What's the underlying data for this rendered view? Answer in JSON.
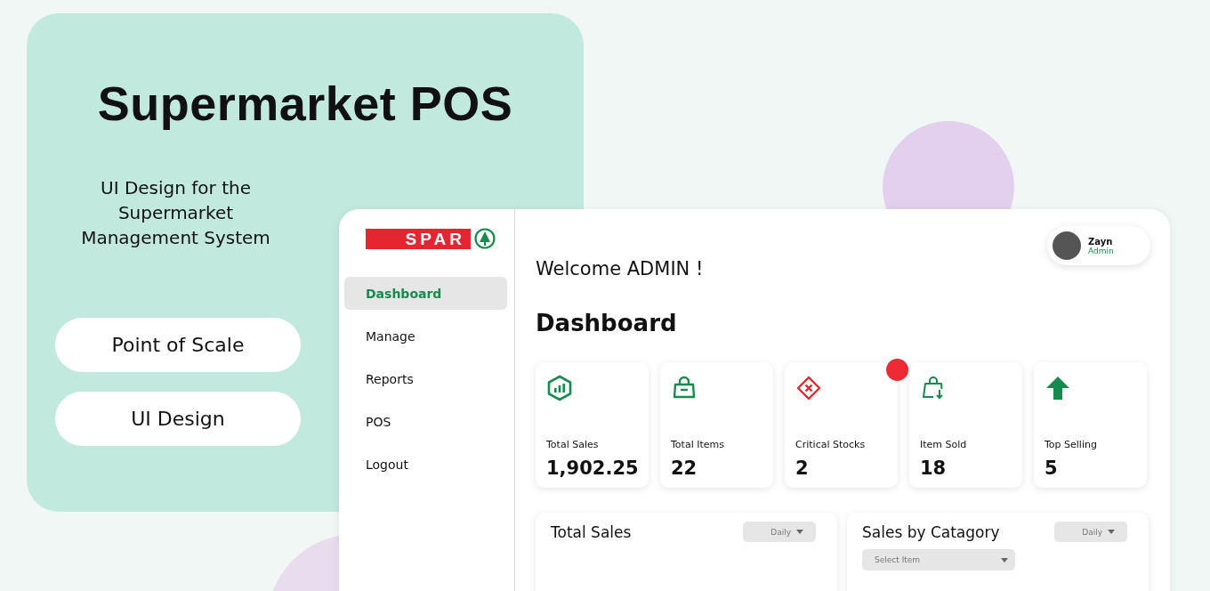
{
  "promo": {
    "title": "Supermarket POS",
    "subtitle": "UI Design for the Supermarket Management System",
    "tags": [
      "Point of Scale",
      "UI Design"
    ]
  },
  "app": {
    "logo": {
      "text": "SPAR"
    },
    "sidebar": {
      "items": [
        {
          "label": "Dashboard",
          "selected": true
        },
        {
          "label": "Manage",
          "selected": false
        },
        {
          "label": "Reports",
          "selected": false
        },
        {
          "label": "POS",
          "selected": false
        },
        {
          "label": "Logout",
          "selected": false
        }
      ]
    },
    "user": {
      "name": "Zayn",
      "role": "Admin"
    },
    "welcome": "Welcome ADMIN !",
    "heading": "Dashboard",
    "stats": [
      {
        "kind": "sales",
        "label": "Total Sales",
        "value": "1,902.25",
        "alert": false
      },
      {
        "kind": "items",
        "label": "Total Items",
        "value": "22",
        "alert": false
      },
      {
        "kind": "critical",
        "label": "Critical Stocks",
        "value": "2",
        "alert": true
      },
      {
        "kind": "sold",
        "label": "Item Sold",
        "value": "18",
        "alert": false
      },
      {
        "kind": "top",
        "label": "Top Selling",
        "value": "5",
        "alert": false
      }
    ],
    "panels": [
      {
        "title": "Total Sales",
        "period": "Daily"
      },
      {
        "title": "Sales by Catagory",
        "period": "Daily",
        "select_placeholder": "Select Item"
      }
    ]
  }
}
